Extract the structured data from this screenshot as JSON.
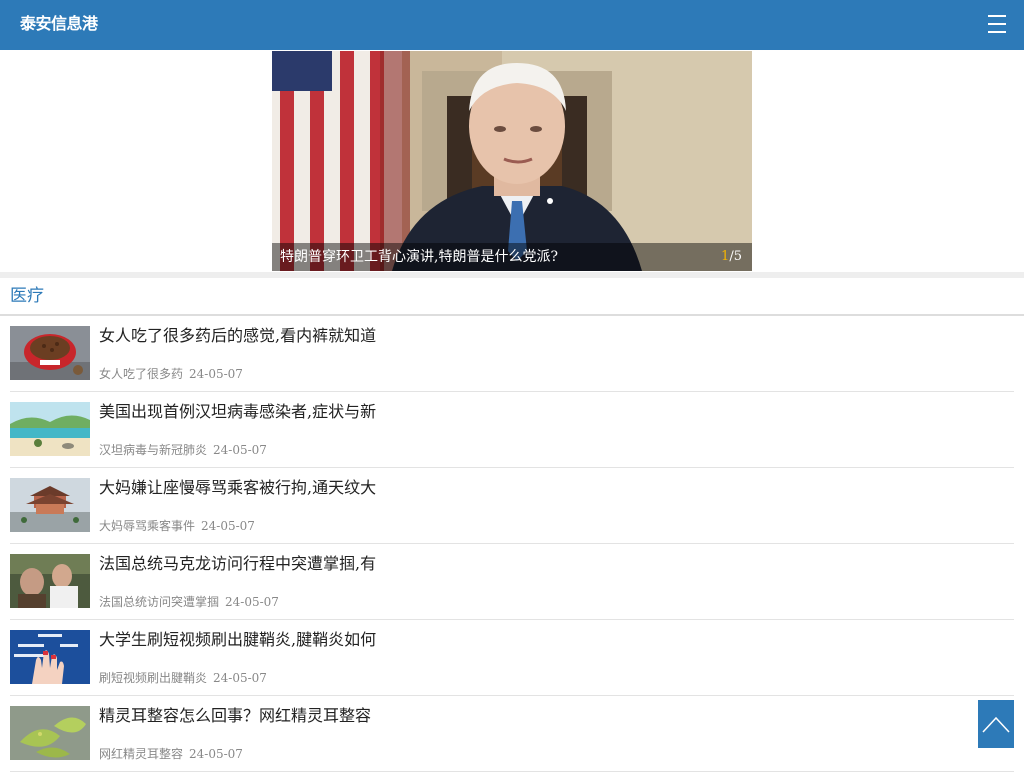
{
  "header": {
    "logo_text": "泰安信息港",
    "menu_icon": "hamburger-menu-icon"
  },
  "slider": {
    "caption": "特朗普穿环卫工背心演讲,特朗普是什么党派?",
    "current": "1",
    "separator": "/",
    "total": "5"
  },
  "section": {
    "title": "医疗"
  },
  "articles": [
    {
      "title": "女人吃了很多药后的感觉,看内裤就知道",
      "tag": "女人吃了很多药",
      "date": "24-05-07"
    },
    {
      "title": "美国出现首例汉坦病毒感染者,症状与新",
      "tag": "汉坦病毒与新冠肺炎",
      "date": "24-05-07"
    },
    {
      "title": "大妈嫌让座慢辱骂乘客被行拘,通天纹大",
      "tag": "大妈辱骂乘客事件",
      "date": "24-05-07"
    },
    {
      "title": "法国总统马克龙访问行程中突遭掌掴,有",
      "tag": "法国总统访问突遭掌掴",
      "date": "24-05-07"
    },
    {
      "title": "大学生刷短视频刷出腱鞘炎,腱鞘炎如何",
      "tag": "刷短视频刷出腱鞘炎",
      "date": "24-05-07"
    },
    {
      "title": "精灵耳整容怎么回事？网红精灵耳整容",
      "tag": "网红精灵耳整容",
      "date": "24-05-07"
    }
  ],
  "back_to_top_icon": "chevron-up-icon",
  "colors": {
    "brand": "#2d7ab8",
    "counter_highlight": "#f5b400"
  }
}
